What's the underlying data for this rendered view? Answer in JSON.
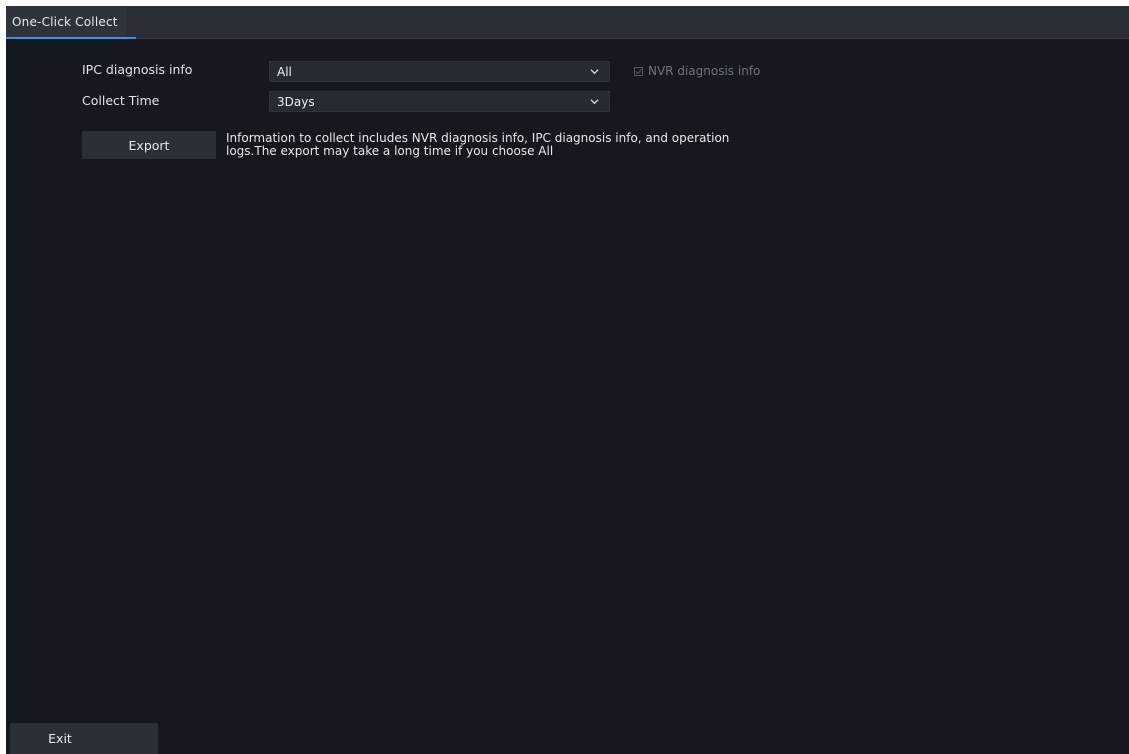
{
  "tab": {
    "title": "One-Click Collect"
  },
  "form": {
    "ipc_label": "IPC diagnosis info",
    "ipc_value": "All",
    "nvr_checkbox_label": "NVR diagnosis info",
    "collect_time_label": "Collect Time",
    "collect_time_value": "3Days"
  },
  "actions": {
    "export_label": "Export",
    "info_line1": "Information to collect includes NVR diagnosis info, IPC diagnosis info, and operation",
    "info_line2": "logs.The export may take a long time if you choose All",
    "exit_label": "Exit"
  },
  "colors": {
    "background": "#15181e",
    "accent": "#3a8fe0",
    "text": "#e6e8ec",
    "disabled_text": "#6f747c"
  },
  "icons": {
    "dropdown": "chevron-down-icon",
    "checkbox": "checkbox-icon"
  }
}
